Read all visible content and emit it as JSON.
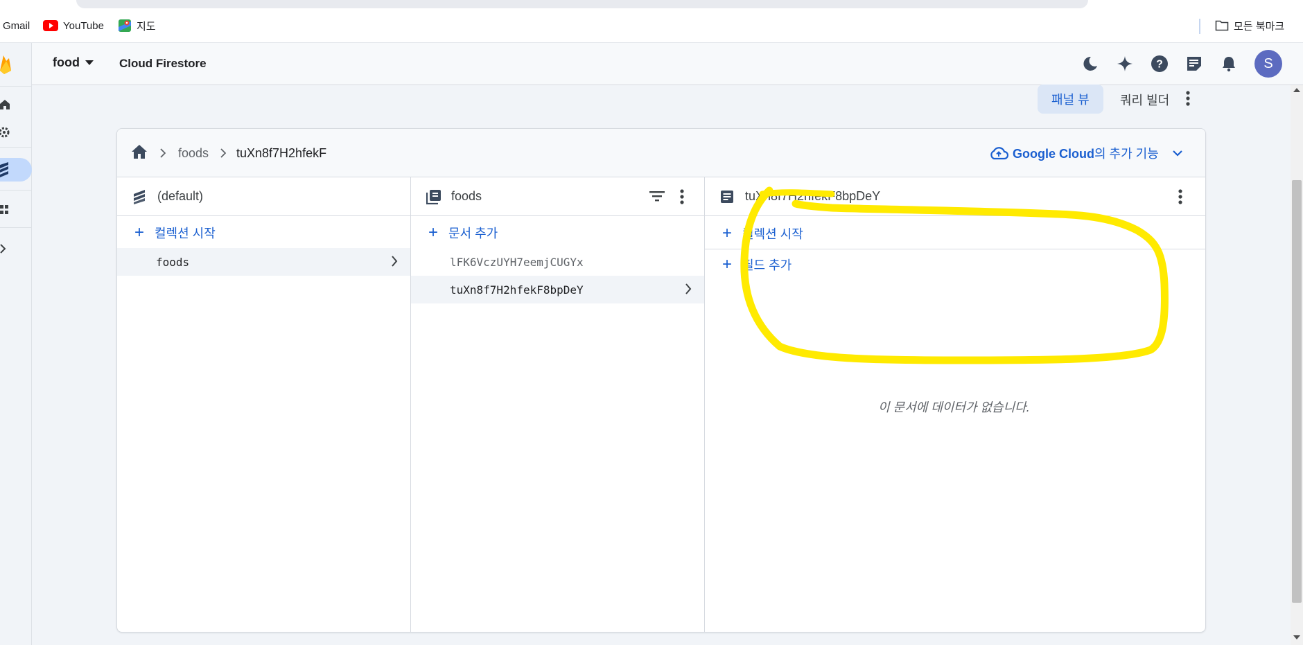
{
  "bookmarks": {
    "items": [
      {
        "label": "Gmail",
        "icon": "gmail-icon"
      },
      {
        "label": "YouTube",
        "icon": "youtube-icon"
      },
      {
        "label": "지도",
        "icon": "maps-icon"
      }
    ],
    "all_bookmarks": "모든 북마크"
  },
  "header": {
    "project": "food",
    "product": "Cloud Firestore",
    "avatar_initial": "S",
    "icons": [
      "dark-mode-icon",
      "gemini-sparkle-icon",
      "help-icon",
      "release-notes-icon",
      "notifications-icon"
    ]
  },
  "view_toggle": {
    "panel_view": "패널 뷰",
    "query_builder": "쿼리 빌더"
  },
  "breadcrumb": {
    "items": [
      "foods",
      "tuXn8f7H2hfekF"
    ],
    "google_cloud_bold": "Google Cloud",
    "google_cloud_rest": "의 추가 기능"
  },
  "columns": {
    "database": {
      "title": "(default)",
      "add_label": "컬렉션 시작",
      "items": [
        "foods"
      ]
    },
    "collection": {
      "title": "foods",
      "add_label": "문서 추가",
      "items": [
        "lFK6VczUYH7eemjCUGYx",
        "tuXn8f7H2hfekF8bpDeY"
      ]
    },
    "document": {
      "title": "tuXn8f7H2hfekF8bpDeY",
      "add_collection_label": "컬렉션 시작",
      "add_field_label": "필드 추가",
      "empty_message": "이 문서에 데이터가 없습니다."
    }
  },
  "colors": {
    "accent": "#1a5fd0",
    "selected_rail": "#c2d9fc",
    "annotation": "#ffea00",
    "avatar": "#5c6bc0"
  }
}
